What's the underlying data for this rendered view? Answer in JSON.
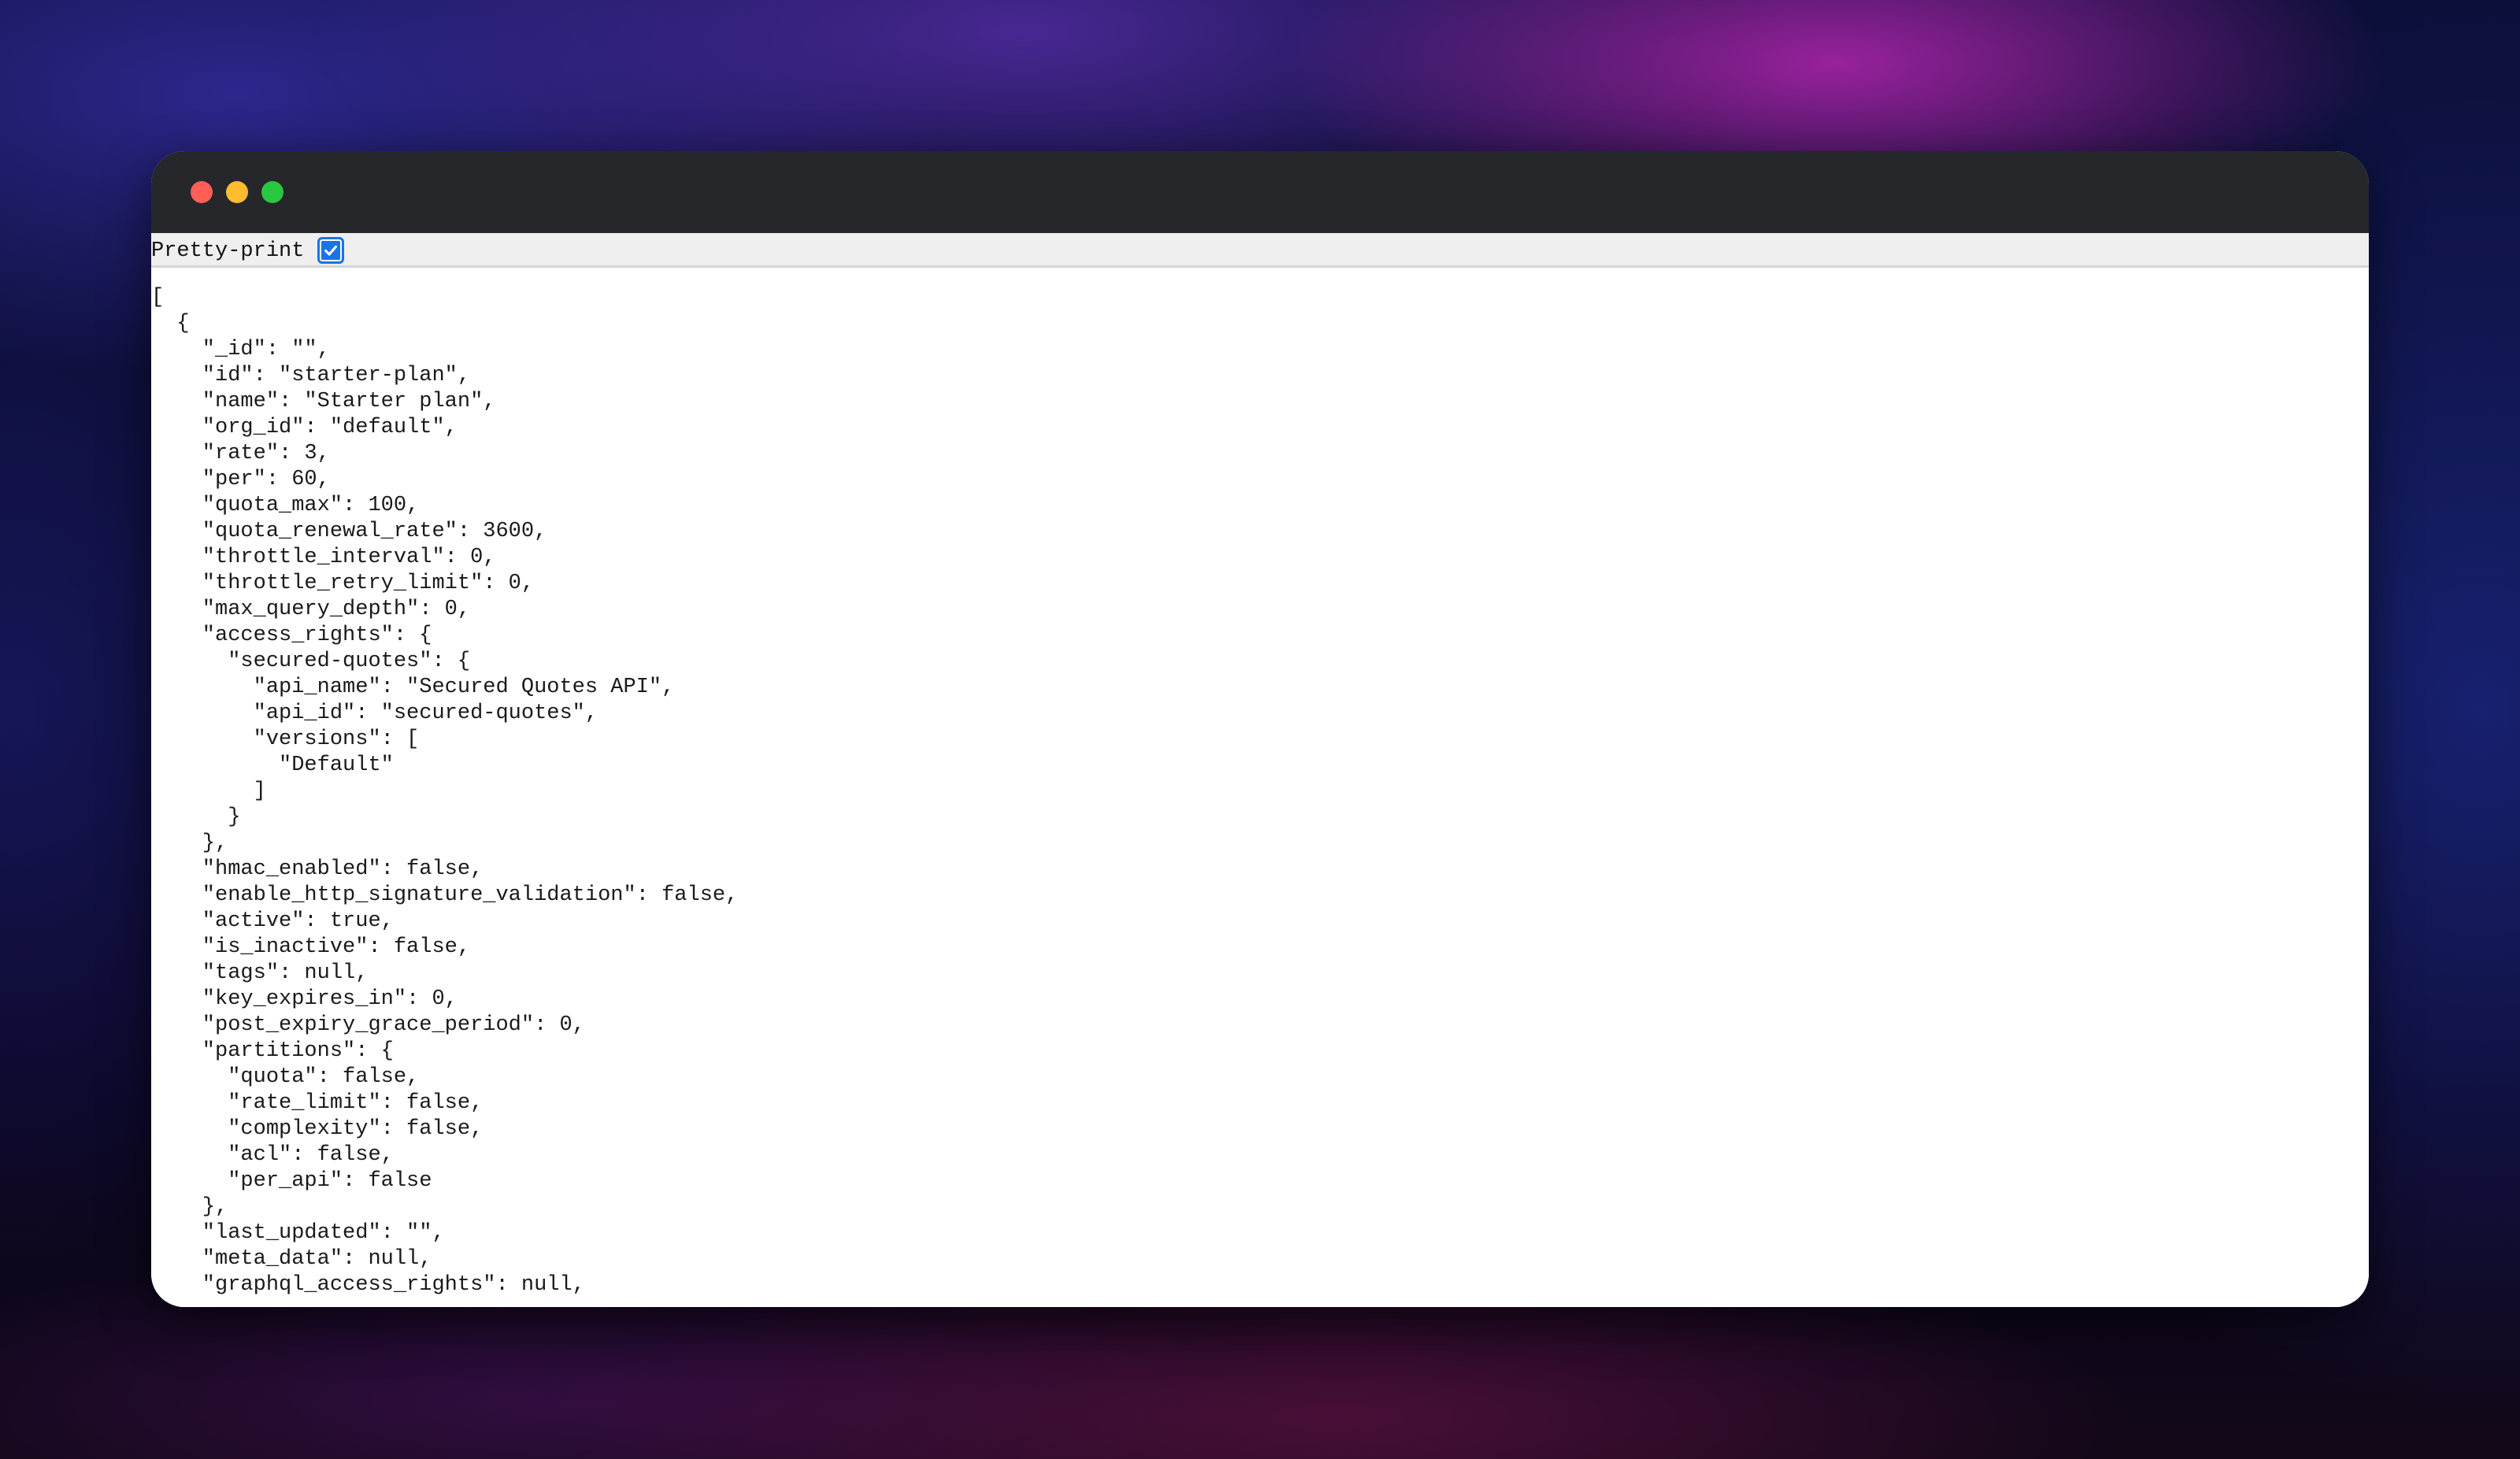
{
  "window": {
    "controls": {
      "close_color": "#ff5f57",
      "minimize_color": "#febc2e",
      "zoom_color": "#28c840"
    }
  },
  "toolbar": {
    "pretty_print_label": "Pretty-print",
    "pretty_print_checked": true,
    "checkbox_color": "#1a73e8"
  },
  "json_lines": [
    "[",
    "  {",
    "    \"_id\": \"\",",
    "    \"id\": \"starter-plan\",",
    "    \"name\": \"Starter plan\",",
    "    \"org_id\": \"default\",",
    "    \"rate\": 3,",
    "    \"per\": 60,",
    "    \"quota_max\": 100,",
    "    \"quota_renewal_rate\": 3600,",
    "    \"throttle_interval\": 0,",
    "    \"throttle_retry_limit\": 0,",
    "    \"max_query_depth\": 0,",
    "    \"access_rights\": {",
    "      \"secured-quotes\": {",
    "        \"api_name\": \"Secured Quotes API\",",
    "        \"api_id\": \"secured-quotes\",",
    "        \"versions\": [",
    "          \"Default\"",
    "        ]",
    "      }",
    "    },",
    "    \"hmac_enabled\": false,",
    "    \"enable_http_signature_validation\": false,",
    "    \"active\": true,",
    "    \"is_inactive\": false,",
    "    \"tags\": null,",
    "    \"key_expires_in\": 0,",
    "    \"post_expiry_grace_period\": 0,",
    "    \"partitions\": {",
    "      \"quota\": false,",
    "      \"rate_limit\": false,",
    "      \"complexity\": false,",
    "      \"acl\": false,",
    "      \"per_api\": false",
    "    },",
    "    \"last_updated\": \"\",",
    "    \"meta_data\": null,",
    "    \"graphql_access_rights\": null,"
  ]
}
